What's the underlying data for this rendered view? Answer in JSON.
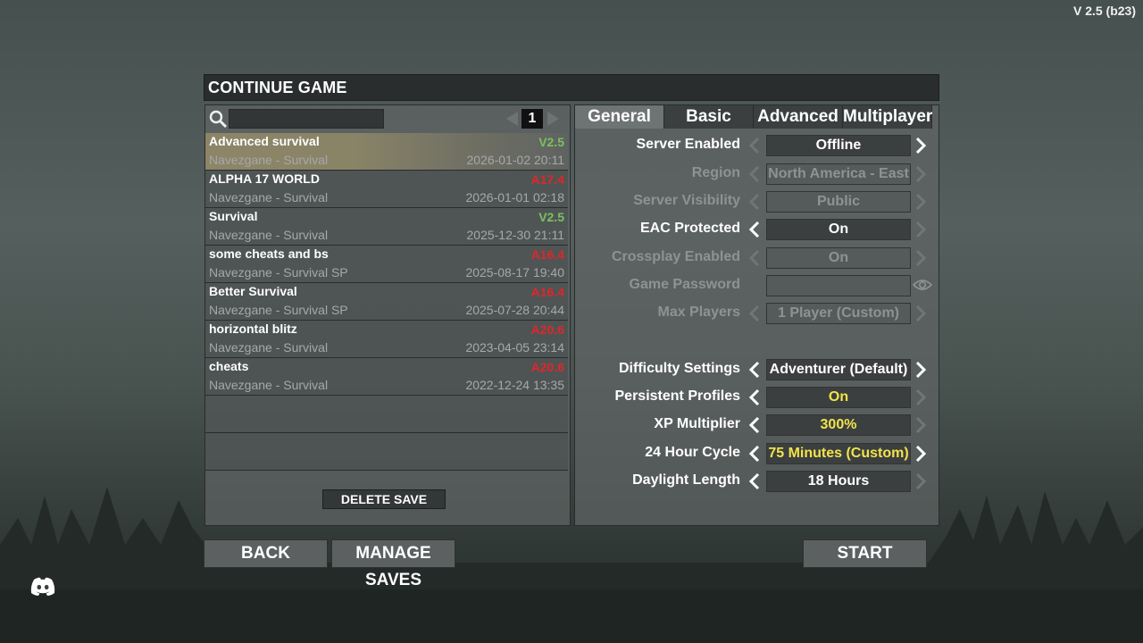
{
  "version": "V 2.5 (b23)",
  "window_title": "CONTINUE GAME",
  "search": {
    "value": "",
    "page": "1"
  },
  "saves": [
    {
      "name": "Advanced survival",
      "version": "V2.5",
      "version_color": "green",
      "world": "Navezgane - Survival",
      "date": "2026-01-02 20:11",
      "selected": true
    },
    {
      "name": "ALPHA 17 WORLD",
      "version": "A17.4",
      "version_color": "red",
      "world": "Navezgane - Survival",
      "date": "2026-01-01 02:18"
    },
    {
      "name": "Survival",
      "version": "V2.5",
      "version_color": "green",
      "world": "Navezgane - Survival",
      "date": "2025-12-30 21:11"
    },
    {
      "name": "some cheats and bs",
      "version": "A16.4",
      "version_color": "red",
      "world": "Navezgane - Survival SP",
      "date": "2025-08-17 19:40"
    },
    {
      "name": "Better Survival",
      "version": "A16.4",
      "version_color": "red",
      "world": "Navezgane - Survival SP",
      "date": "2025-07-28 20:44"
    },
    {
      "name": "horizontal blitz",
      "version": "A20.6",
      "version_color": "red",
      "world": "Navezgane - Survival",
      "date": "2023-04-05 23:14"
    },
    {
      "name": "cheats",
      "version": "A20.6",
      "version_color": "red",
      "world": "Navezgane - Survival",
      "date": "2022-12-24 13:35"
    }
  ],
  "delete_save_label": "DELETE SAVE",
  "tabs": [
    "General",
    "Basic",
    "Advanced",
    "Multiplayer"
  ],
  "settings": [
    {
      "label": "Server Enabled",
      "value": "Offline",
      "enabled": true
    },
    {
      "label": "Region",
      "value": "North America - East",
      "enabled": false
    },
    {
      "label": "Server Visibility",
      "value": "Public",
      "enabled": false
    },
    {
      "label": "EAC Protected",
      "value": "On",
      "enabled": true
    },
    {
      "label": "Crossplay Enabled",
      "value": "On",
      "enabled": false
    },
    {
      "label": "Game Password",
      "value": "",
      "enabled": false
    },
    {
      "label": "Max Players",
      "value": "1 Player (Custom)",
      "enabled": false
    },
    {
      "label": "Difficulty Settings",
      "value": "Adventurer (Default)",
      "enabled": true
    },
    {
      "label": "Persistent Profiles",
      "value": "On",
      "enabled": true
    },
    {
      "label": "XP Multiplier",
      "value": "300%",
      "enabled": true
    },
    {
      "label": "24 Hour Cycle",
      "value": "75 Minutes (Custom)",
      "enabled": true
    },
    {
      "label": "Daylight Length",
      "value": "18 Hours",
      "enabled": true
    }
  ],
  "buttons": {
    "back": "BACK",
    "manage_saves": "MANAGE SAVES",
    "start": "START"
  },
  "colors": {
    "highlight_value": "#f2e34a",
    "version_green": "#7cc05e",
    "version_red": "#e0262a"
  }
}
